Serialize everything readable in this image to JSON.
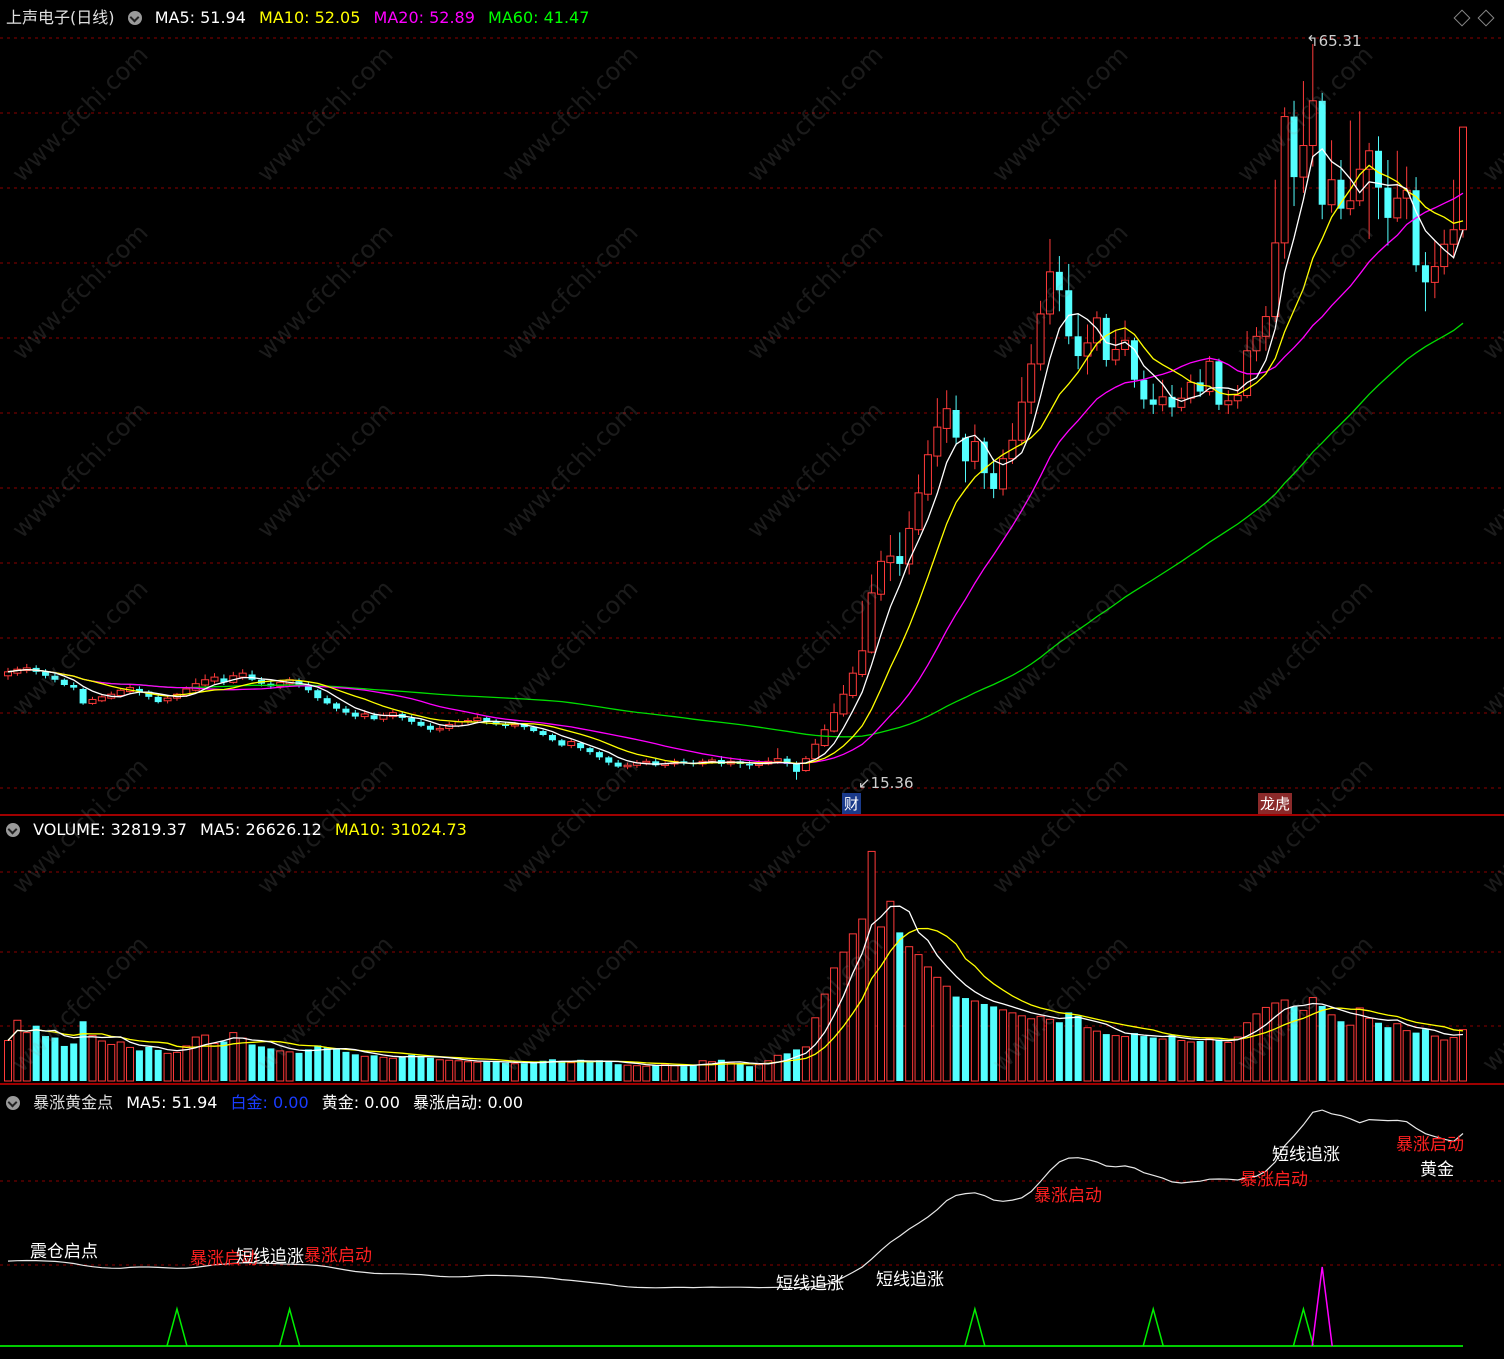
{
  "header": {
    "title": "上声电子(日线)",
    "ma5_label": "MA5:",
    "ma5_value": "51.94",
    "ma10_label": "MA10:",
    "ma10_value": "52.05",
    "ma20_label": "MA20:",
    "ma20_value": "52.89",
    "ma60_label": "MA60:",
    "ma60_value": "41.47"
  },
  "price_pane": {
    "high_label": "65.31",
    "low_label": "15.36",
    "badge_cai": "财",
    "badge_longhu": "龙虎"
  },
  "volume_pane": {
    "label": "VOLUME:",
    "value": "32819.37",
    "ma5_label": "MA5:",
    "ma5_value": "26626.12",
    "ma10_label": "MA10:",
    "ma10_value": "31024.73"
  },
  "indicator_pane": {
    "name": "暴涨黄金点",
    "ma5_label": "MA5:",
    "ma5_value": "51.94",
    "baijin_label": "白金:",
    "baijin_value": "0.00",
    "huangjin_label": "黄金:",
    "huangjin_value": "0.00",
    "qidong_label": "暴涨启动:",
    "qidong_value": "0.00",
    "signals": [
      {
        "text": "震仓启点",
        "color": "#ffffff"
      },
      {
        "text": "暴涨启动",
        "color": "#ff2020"
      },
      {
        "text": "短线追涨",
        "color": "#ffffff"
      },
      {
        "text": "暴涨启动",
        "color": "#ff2020"
      },
      {
        "text": "短线追涨",
        "color": "#ffffff"
      },
      {
        "text": "短线追涨",
        "color": "#ffffff"
      },
      {
        "text": "暴涨启动",
        "color": "#ff2020"
      },
      {
        "text": "短线追涨",
        "color": "#ffffff"
      },
      {
        "text": "暴涨启动",
        "color": "#ff2020"
      },
      {
        "text": "暴涨启动",
        "color": "#ff2020"
      },
      {
        "text": "黄金",
        "color": "#ffffff"
      }
    ]
  },
  "watermark": "www.cfchi.com",
  "colors": {
    "up": "#ff3a3a",
    "down": "#54ffff",
    "ma5": "#ffffff",
    "ma10": "#ffff00",
    "ma20": "#ff00ff",
    "ma60": "#00dd00",
    "grid": "#8a0000",
    "border": "#a00000"
  },
  "chart_data": {
    "type": "candlestick",
    "title": "上声电子(日线)",
    "bars": [
      {
        "o": 17.3,
        "c": 17.6,
        "h": 17.9,
        "l": 17.0,
        "v": 8200
      },
      {
        "o": 17.5,
        "c": 17.8,
        "h": 18.0,
        "l": 17.3,
        "v": 12300
      },
      {
        "o": 17.7,
        "c": 17.9,
        "h": 18.2,
        "l": 17.5,
        "v": 9800
      },
      {
        "o": 17.9,
        "c": 17.6,
        "h": 18.1,
        "l": 17.4,
        "v": 11200
      },
      {
        "o": 17.6,
        "c": 17.3,
        "h": 17.8,
        "l": 17.1,
        "v": 9100
      },
      {
        "o": 17.3,
        "c": 17.0,
        "h": 17.5,
        "l": 16.8,
        "v": 8800
      },
      {
        "o": 17.0,
        "c": 16.6,
        "h": 17.1,
        "l": 16.5,
        "v": 7100
      },
      {
        "o": 16.6,
        "c": 16.4,
        "h": 16.8,
        "l": 16.2,
        "v": 7600
      },
      {
        "o": 16.3,
        "c": 15.2,
        "h": 16.4,
        "l": 15.1,
        "v": 12100
      },
      {
        "o": 15.2,
        "c": 15.5,
        "h": 15.7,
        "l": 15.1,
        "v": 9200
      },
      {
        "o": 15.4,
        "c": 15.7,
        "h": 15.9,
        "l": 15.3,
        "v": 8100
      },
      {
        "o": 15.6,
        "c": 15.9,
        "h": 16.1,
        "l": 15.5,
        "v": 7400
      },
      {
        "o": 15.8,
        "c": 16.2,
        "h": 16.3,
        "l": 15.7,
        "v": 7900
      },
      {
        "o": 16.1,
        "c": 16.4,
        "h": 16.6,
        "l": 15.9,
        "v": 6800
      },
      {
        "o": 16.3,
        "c": 16.1,
        "h": 16.5,
        "l": 15.8,
        "v": 6200
      },
      {
        "o": 16.1,
        "c": 15.7,
        "h": 16.2,
        "l": 15.5,
        "v": 6900
      },
      {
        "o": 15.7,
        "c": 15.3,
        "h": 15.9,
        "l": 15.2,
        "v": 6300
      },
      {
        "o": 15.4,
        "c": 15.6,
        "h": 15.8,
        "l": 15.2,
        "v": 5600
      },
      {
        "o": 15.6,
        "c": 15.9,
        "h": 16.0,
        "l": 15.4,
        "v": 5800
      },
      {
        "o": 15.8,
        "c": 16.3,
        "h": 16.5,
        "l": 15.7,
        "v": 7100
      },
      {
        "o": 16.2,
        "c": 16.7,
        "h": 17.1,
        "l": 16.1,
        "v": 8900
      },
      {
        "o": 16.6,
        "c": 17.0,
        "h": 17.4,
        "l": 16.5,
        "v": 9300
      },
      {
        "o": 16.9,
        "c": 17.2,
        "h": 17.5,
        "l": 16.7,
        "v": 7600
      },
      {
        "o": 17.1,
        "c": 16.8,
        "h": 17.4,
        "l": 16.6,
        "v": 8000
      },
      {
        "o": 16.8,
        "c": 17.3,
        "h": 17.6,
        "l": 16.7,
        "v": 9800
      },
      {
        "o": 17.2,
        "c": 17.5,
        "h": 17.8,
        "l": 17.0,
        "v": 8700
      },
      {
        "o": 17.4,
        "c": 17.0,
        "h": 17.7,
        "l": 16.9,
        "v": 7400
      },
      {
        "o": 17.0,
        "c": 16.7,
        "h": 17.2,
        "l": 16.5,
        "v": 7000
      },
      {
        "o": 16.7,
        "c": 16.5,
        "h": 16.9,
        "l": 16.3,
        "v": 6600
      },
      {
        "o": 16.5,
        "c": 16.8,
        "h": 17.0,
        "l": 16.3,
        "v": 6100
      },
      {
        "o": 16.7,
        "c": 17.0,
        "h": 17.2,
        "l": 16.5,
        "v": 5900
      },
      {
        "o": 16.9,
        "c": 16.6,
        "h": 17.1,
        "l": 16.4,
        "v": 5700
      },
      {
        "o": 16.6,
        "c": 16.2,
        "h": 16.8,
        "l": 16.0,
        "v": 6400
      },
      {
        "o": 16.2,
        "c": 15.6,
        "h": 16.3,
        "l": 15.4,
        "v": 7200
      },
      {
        "o": 15.6,
        "c": 15.2,
        "h": 15.8,
        "l": 15.1,
        "v": 6800
      },
      {
        "o": 15.2,
        "c": 14.8,
        "h": 15.3,
        "l": 14.6,
        "v": 6500
      },
      {
        "o": 14.8,
        "c": 14.5,
        "h": 15.0,
        "l": 14.3,
        "v": 5900
      },
      {
        "o": 14.5,
        "c": 14.2,
        "h": 14.7,
        "l": 14.0,
        "v": 5400
      },
      {
        "o": 14.2,
        "c": 14.4,
        "h": 14.7,
        "l": 14.0,
        "v": 5000
      },
      {
        "o": 14.3,
        "c": 14.0,
        "h": 14.5,
        "l": 13.9,
        "v": 5200
      },
      {
        "o": 14.0,
        "c": 14.3,
        "h": 14.5,
        "l": 13.8,
        "v": 4800
      },
      {
        "o": 14.2,
        "c": 14.5,
        "h": 14.7,
        "l": 14.0,
        "v": 4600
      },
      {
        "o": 14.4,
        "c": 14.1,
        "h": 14.6,
        "l": 13.9,
        "v": 4900
      },
      {
        "o": 14.1,
        "c": 13.8,
        "h": 14.3,
        "l": 13.6,
        "v": 5300
      },
      {
        "o": 13.8,
        "c": 13.5,
        "h": 14.0,
        "l": 13.4,
        "v": 5100
      },
      {
        "o": 13.5,
        "c": 13.2,
        "h": 13.7,
        "l": 13.0,
        "v": 4700
      },
      {
        "o": 13.2,
        "c": 13.3,
        "h": 13.5,
        "l": 13.0,
        "v": 4300
      },
      {
        "o": 13.3,
        "c": 13.6,
        "h": 13.8,
        "l": 13.1,
        "v": 4200
      },
      {
        "o": 13.5,
        "c": 13.8,
        "h": 14.0,
        "l": 13.4,
        "v": 4100
      },
      {
        "o": 13.8,
        "c": 13.9,
        "h": 14.1,
        "l": 13.6,
        "v": 3900
      },
      {
        "o": 13.9,
        "c": 14.1,
        "h": 14.3,
        "l": 13.7,
        "v": 3800
      },
      {
        "o": 14.1,
        "c": 13.8,
        "h": 14.2,
        "l": 13.6,
        "v": 4000
      },
      {
        "o": 13.8,
        "c": 13.6,
        "h": 14.0,
        "l": 13.5,
        "v": 3900
      },
      {
        "o": 13.6,
        "c": 13.5,
        "h": 13.8,
        "l": 13.3,
        "v": 3700
      },
      {
        "o": 13.5,
        "c": 13.6,
        "h": 13.8,
        "l": 13.3,
        "v": 3500
      },
      {
        "o": 13.6,
        "c": 13.4,
        "h": 13.7,
        "l": 13.2,
        "v": 3600
      },
      {
        "o": 13.4,
        "c": 13.1,
        "h": 13.5,
        "l": 13.0,
        "v": 3800
      },
      {
        "o": 13.1,
        "c": 12.8,
        "h": 13.2,
        "l": 12.7,
        "v": 4100
      },
      {
        "o": 12.8,
        "c": 12.4,
        "h": 12.9,
        "l": 12.3,
        "v": 4400
      },
      {
        "o": 12.4,
        "c": 12.0,
        "h": 12.5,
        "l": 11.9,
        "v": 4000
      },
      {
        "o": 12.0,
        "c": 12.3,
        "h": 12.5,
        "l": 11.8,
        "v": 3700
      },
      {
        "o": 12.2,
        "c": 11.8,
        "h": 12.3,
        "l": 11.6,
        "v": 4300
      },
      {
        "o": 11.8,
        "c": 11.5,
        "h": 11.9,
        "l": 11.3,
        "v": 3900
      },
      {
        "o": 11.5,
        "c": 11.1,
        "h": 11.6,
        "l": 10.9,
        "v": 4200
      },
      {
        "o": 11.1,
        "c": 10.7,
        "h": 11.2,
        "l": 10.5,
        "v": 3900
      },
      {
        "o": 10.7,
        "c": 10.4,
        "h": 10.9,
        "l": 10.3,
        "v": 3400
      },
      {
        "o": 10.4,
        "c": 10.5,
        "h": 10.7,
        "l": 10.2,
        "v": 3200
      },
      {
        "o": 10.5,
        "c": 10.7,
        "h": 10.9,
        "l": 10.3,
        "v": 3100
      },
      {
        "o": 10.7,
        "c": 10.8,
        "h": 11.0,
        "l": 10.5,
        "v": 3000
      },
      {
        "o": 10.8,
        "c": 10.5,
        "h": 11.0,
        "l": 10.4,
        "v": 3200
      },
      {
        "o": 10.5,
        "c": 10.6,
        "h": 10.8,
        "l": 10.3,
        "v": 3300
      },
      {
        "o": 10.6,
        "c": 10.8,
        "h": 11.0,
        "l": 10.4,
        "v": 3100
      },
      {
        "o": 10.8,
        "c": 10.7,
        "h": 11.0,
        "l": 10.5,
        "v": 3000
      },
      {
        "o": 10.7,
        "c": 10.6,
        "h": 10.9,
        "l": 10.4,
        "v": 3200
      },
      {
        "o": 10.6,
        "c": 10.8,
        "h": 11.0,
        "l": 10.4,
        "v": 4100
      },
      {
        "o": 10.8,
        "c": 10.9,
        "h": 11.1,
        "l": 10.6,
        "v": 3900
      },
      {
        "o": 10.9,
        "c": 10.6,
        "h": 11.2,
        "l": 10.4,
        "v": 4300
      },
      {
        "o": 10.6,
        "c": 10.8,
        "h": 11.1,
        "l": 10.4,
        "v": 3600
      },
      {
        "o": 10.8,
        "c": 10.6,
        "h": 11.0,
        "l": 10.3,
        "v": 3400
      },
      {
        "o": 10.6,
        "c": 10.5,
        "h": 10.8,
        "l": 10.2,
        "v": 3000
      },
      {
        "o": 10.5,
        "c": 10.6,
        "h": 10.9,
        "l": 10.3,
        "v": 3300
      },
      {
        "o": 10.6,
        "c": 10.8,
        "h": 11.1,
        "l": 10.5,
        "v": 4100
      },
      {
        "o": 10.8,
        "c": 11.0,
        "h": 11.8,
        "l": 10.6,
        "v": 5200
      },
      {
        "o": 11.0,
        "c": 10.6,
        "h": 11.2,
        "l": 10.4,
        "v": 5600
      },
      {
        "o": 10.6,
        "c": 10.0,
        "h": 10.8,
        "l": 9.4,
        "v": 6400
      },
      {
        "o": 10.1,
        "c": 11.0,
        "h": 11.2,
        "l": 10.0,
        "v": 6900
      },
      {
        "o": 11.0,
        "c": 12.1,
        "h": 12.5,
        "l": 10.9,
        "v": 12800
      },
      {
        "o": 12.0,
        "c": 13.2,
        "h": 13.6,
        "l": 11.9,
        "v": 17600
      },
      {
        "o": 13.1,
        "c": 14.5,
        "h": 15.2,
        "l": 13.0,
        "v": 22900
      },
      {
        "o": 14.4,
        "c": 15.9,
        "h": 16.6,
        "l": 14.2,
        "v": 26100
      },
      {
        "o": 15.8,
        "c": 17.5,
        "h": 18.0,
        "l": 15.6,
        "v": 29800
      },
      {
        "o": 17.4,
        "c": 19.2,
        "h": 23.0,
        "l": 17.2,
        "v": 32800
      },
      {
        "o": 19.1,
        "c": 23.6,
        "h": 25.0,
        "l": 19.0,
        "v": 46500
      },
      {
        "o": 23.5,
        "c": 26.0,
        "h": 26.8,
        "l": 23.0,
        "v": 31200
      },
      {
        "o": 25.9,
        "c": 26.4,
        "h": 28.0,
        "l": 24.5,
        "v": 36400
      },
      {
        "o": 26.4,
        "c": 25.8,
        "h": 28.2,
        "l": 24.9,
        "v": 30100
      },
      {
        "o": 25.8,
        "c": 28.5,
        "h": 29.8,
        "l": 25.0,
        "v": 27200
      },
      {
        "o": 28.4,
        "c": 31.2,
        "h": 32.6,
        "l": 28.0,
        "v": 25600
      },
      {
        "o": 31.1,
        "c": 34.1,
        "h": 35.2,
        "l": 30.6,
        "v": 23100
      },
      {
        "o": 34.0,
        "c": 36.2,
        "h": 38.4,
        "l": 33.2,
        "v": 21000
      },
      {
        "o": 36.1,
        "c": 37.6,
        "h": 39.0,
        "l": 35.0,
        "v": 19200
      },
      {
        "o": 37.5,
        "c": 35.4,
        "h": 38.6,
        "l": 34.8,
        "v": 17100
      },
      {
        "o": 35.4,
        "c": 33.6,
        "h": 35.7,
        "l": 32.0,
        "v": 16800
      },
      {
        "o": 33.6,
        "c": 35.1,
        "h": 36.4,
        "l": 33.0,
        "v": 16200
      },
      {
        "o": 35.1,
        "c": 32.7,
        "h": 35.4,
        "l": 31.5,
        "v": 15600
      },
      {
        "o": 32.7,
        "c": 31.5,
        "h": 33.8,
        "l": 30.8,
        "v": 15100
      },
      {
        "o": 31.5,
        "c": 33.8,
        "h": 34.5,
        "l": 31.0,
        "v": 14400
      },
      {
        "o": 33.8,
        "c": 35.2,
        "h": 36.5,
        "l": 33.4,
        "v": 13800
      },
      {
        "o": 35.2,
        "c": 38.1,
        "h": 40.0,
        "l": 34.8,
        "v": 13200
      },
      {
        "o": 38.1,
        "c": 41.0,
        "h": 42.5,
        "l": 37.2,
        "v": 12600
      },
      {
        "o": 41.0,
        "c": 44.8,
        "h": 45.8,
        "l": 40.5,
        "v": 13100
      },
      {
        "o": 44.8,
        "c": 48.0,
        "h": 50.5,
        "l": 44.0,
        "v": 12500
      },
      {
        "o": 48.0,
        "c": 46.6,
        "h": 49.2,
        "l": 45.0,
        "v": 11900
      },
      {
        "o": 46.6,
        "c": 43.1,
        "h": 48.6,
        "l": 42.5,
        "v": 13900
      },
      {
        "o": 43.1,
        "c": 41.6,
        "h": 44.8,
        "l": 40.6,
        "v": 13200
      },
      {
        "o": 41.6,
        "c": 42.6,
        "h": 44.0,
        "l": 40.2,
        "v": 10800
      },
      {
        "o": 42.6,
        "c": 44.5,
        "h": 45.0,
        "l": 42.0,
        "v": 10100
      },
      {
        "o": 44.5,
        "c": 41.3,
        "h": 44.8,
        "l": 40.8,
        "v": 9500
      },
      {
        "o": 41.3,
        "c": 42.1,
        "h": 43.6,
        "l": 40.9,
        "v": 9200
      },
      {
        "o": 42.1,
        "c": 42.8,
        "h": 44.3,
        "l": 41.6,
        "v": 9000
      },
      {
        "o": 42.8,
        "c": 39.8,
        "h": 43.0,
        "l": 39.2,
        "v": 9700
      },
      {
        "o": 39.8,
        "c": 38.3,
        "h": 40.5,
        "l": 37.6,
        "v": 9100
      },
      {
        "o": 38.3,
        "c": 37.9,
        "h": 39.5,
        "l": 37.2,
        "v": 8800
      },
      {
        "o": 37.9,
        "c": 38.5,
        "h": 39.8,
        "l": 37.4,
        "v": 8500
      },
      {
        "o": 38.5,
        "c": 37.7,
        "h": 39.4,
        "l": 37.0,
        "v": 9300
      },
      {
        "o": 37.7,
        "c": 38.4,
        "h": 39.2,
        "l": 37.4,
        "v": 8200
      },
      {
        "o": 38.4,
        "c": 39.6,
        "h": 40.2,
        "l": 38.0,
        "v": 7900
      },
      {
        "o": 39.6,
        "c": 38.9,
        "h": 40.6,
        "l": 38.5,
        "v": 8100
      },
      {
        "o": 38.9,
        "c": 41.2,
        "h": 41.6,
        "l": 38.6,
        "v": 8600
      },
      {
        "o": 41.2,
        "c": 37.9,
        "h": 41.4,
        "l": 37.5,
        "v": 8400
      },
      {
        "o": 37.9,
        "c": 38.2,
        "h": 39.0,
        "l": 37.2,
        "v": 7800
      },
      {
        "o": 38.2,
        "c": 38.6,
        "h": 39.4,
        "l": 37.6,
        "v": 8900
      },
      {
        "o": 38.6,
        "c": 42.0,
        "h": 43.5,
        "l": 38.4,
        "v": 11800
      },
      {
        "o": 42.0,
        "c": 43.1,
        "h": 43.8,
        "l": 41.2,
        "v": 13600
      },
      {
        "o": 43.1,
        "c": 44.6,
        "h": 45.4,
        "l": 42.0,
        "v": 14900
      },
      {
        "o": 44.6,
        "c": 50.2,
        "h": 55.0,
        "l": 44.2,
        "v": 15800
      },
      {
        "o": 50.2,
        "c": 59.8,
        "h": 60.5,
        "l": 49.0,
        "v": 16400
      },
      {
        "o": 59.8,
        "c": 55.2,
        "h": 61.0,
        "l": 53.0,
        "v": 15100
      },
      {
        "o": 55.2,
        "c": 57.6,
        "h": 62.5,
        "l": 54.0,
        "v": 14300
      },
      {
        "o": 57.6,
        "c": 61.0,
        "h": 65.31,
        "l": 56.0,
        "v": 16900
      },
      {
        "o": 61.0,
        "c": 53.1,
        "h": 61.6,
        "l": 52.0,
        "v": 15200
      },
      {
        "o": 53.1,
        "c": 55.0,
        "h": 58.0,
        "l": 52.5,
        "v": 13400
      },
      {
        "o": 55.0,
        "c": 52.8,
        "h": 56.5,
        "l": 52.0,
        "v": 12100
      },
      {
        "o": 52.8,
        "c": 53.4,
        "h": 59.5,
        "l": 52.3,
        "v": 11300
      },
      {
        "o": 53.4,
        "c": 55.8,
        "h": 60.2,
        "l": 53.0,
        "v": 14800
      },
      {
        "o": 55.8,
        "c": 57.2,
        "h": 57.8,
        "l": 50.5,
        "v": 12700
      },
      {
        "o": 57.2,
        "c": 54.4,
        "h": 58.3,
        "l": 52.0,
        "v": 11800
      },
      {
        "o": 54.4,
        "c": 52.1,
        "h": 56.5,
        "l": 50.0,
        "v": 10900
      },
      {
        "o": 52.1,
        "c": 53.6,
        "h": 57.2,
        "l": 51.8,
        "v": 11600
      },
      {
        "o": 53.6,
        "c": 54.2,
        "h": 56.0,
        "l": 52.0,
        "v": 10200
      },
      {
        "o": 54.2,
        "c": 48.5,
        "h": 55.2,
        "l": 48.0,
        "v": 9800
      },
      {
        "o": 48.5,
        "c": 47.2,
        "h": 49.5,
        "l": 45.0,
        "v": 10500
      },
      {
        "o": 47.2,
        "c": 48.4,
        "h": 50.4,
        "l": 46.0,
        "v": 9100
      },
      {
        "o": 48.4,
        "c": 50.1,
        "h": 51.2,
        "l": 47.8,
        "v": 8300
      },
      {
        "o": 50.1,
        "c": 51.2,
        "h": 55.0,
        "l": 49.0,
        "v": 8800
      },
      {
        "o": 51.2,
        "c": 59.0,
        "h": 59.0,
        "l": 50.6,
        "v": 10400
      }
    ],
    "ylim": [
      9,
      66
    ],
    "ma_lines": {
      "MA5": "51.94",
      "MA10": "52.05",
      "MA20": "52.89",
      "MA60": "41.47"
    },
    "price_high": 65.31,
    "price_low": 15.36,
    "volume": {
      "value": 32819.37,
      "ma5": 26626.12,
      "ma10": 31024.73
    },
    "indicator": {
      "name": "暴涨黄金点",
      "ma5": 51.94,
      "baijin": 0.0,
      "huangjin": 0.0,
      "qidong": 0.0
    }
  }
}
